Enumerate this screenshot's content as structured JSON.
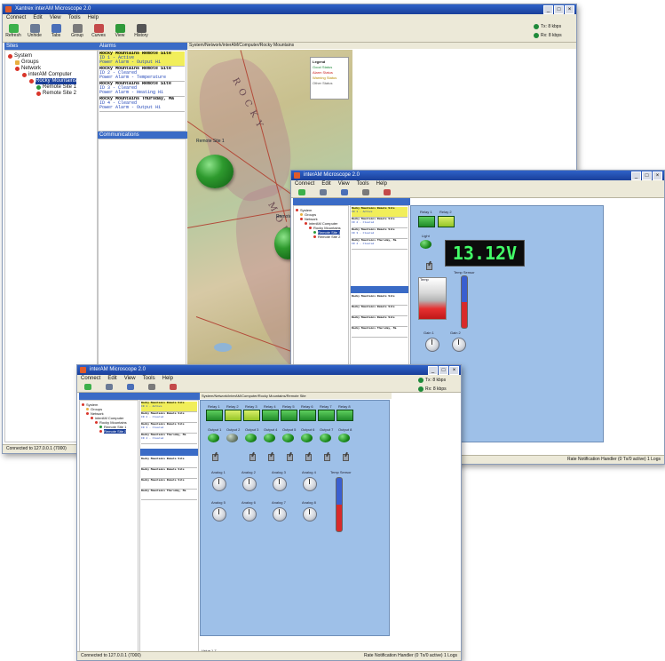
{
  "win1": {
    "title": "Xantrex interAM Microscope 2.0",
    "menu": [
      "Connect",
      "Edit",
      "View",
      "Tools",
      "Help"
    ],
    "toolbar": [
      "Refresh",
      "Unhide",
      "Tabs",
      "Group",
      "Curves",
      "View",
      "History"
    ],
    "speed": [
      "Tx: 8 kbps",
      "Rx: 8 kbps"
    ],
    "sites_header": "Sites",
    "alarms_header": "Alarms",
    "comms_header": "Communications",
    "map_path": "System/Network/interAM/Computer/Rocky Mountains",
    "tree": [
      "System",
      "Groups",
      "Network",
      "interAM Computer",
      "Rocky Mountains",
      "Remote Site 1",
      "Remote Site 2"
    ],
    "alarms": [
      {
        "title": "Rocky Mountains Remote Site",
        "line2": "ID 1 - Active",
        "line3": "Power Alarm - Output Hi"
      },
      {
        "title": "Rocky Mountains Remote Site",
        "line2": "ID 2 - Cleared",
        "line3": "Power Alarm - Temperature"
      },
      {
        "title": "Rocky Mountains Remote Site",
        "line2": "ID 3 - Cleared",
        "line3": "Power Alarm - Heating Hi"
      },
      {
        "title": "Rocky Mountains Thursday, Ma",
        "line2": "ID 4 - Cleared",
        "line3": "Power Alarm - Output Hi"
      }
    ],
    "map_labels": [
      "ROCKY",
      "MOUNTAINS"
    ],
    "site_label_1": "Remote Site 1",
    "site_label_2": "Remote Site 2",
    "legend": [
      "Legend",
      "Good Status",
      "Alarm Status",
      "Warning Status",
      "Other Status"
    ],
    "status": "Connected to 127.0.0.1 (7000)"
  },
  "win2": {
    "title": "interAM Microscope 2.0",
    "menu": [
      "Connect",
      "Edit",
      "View",
      "Tools",
      "Help"
    ],
    "lcd_value": "13.12V",
    "buttons": [
      "Relay 1",
      "Relay 2"
    ],
    "labels": {
      "led": "Light",
      "gauge": "Temp",
      "therm": "Temp Sensor",
      "knob1": "Gain 1",
      "knob2": "Gain 2"
    },
    "status": "Rate Notification Handler (0 Tx/0 active)   1 Logs"
  },
  "win3": {
    "title": "interAM Microscope 2.0",
    "menu": [
      "Connect",
      "Edit",
      "View",
      "Tools",
      "Help"
    ],
    "path": "System/Network/interAM/Computer/Rocky Mountains/Remote Site",
    "relays": [
      "Relay 1",
      "Relay 2",
      "Relay 3",
      "Relay 4",
      "Relay 5",
      "Relay 6",
      "Relay 7",
      "Relay 8"
    ],
    "outputs": [
      "Output 1",
      "Output 2",
      "Output 3",
      "Output 4",
      "Output 5",
      "Output 6",
      "Output 7",
      "Output 8"
    ],
    "analogs": [
      "Analog 1",
      "Analog 2",
      "Analog 3",
      "Analog 4",
      "Analog 5",
      "Analog 6",
      "Analog 7",
      "Analog 8"
    ],
    "therm_label": "Temp Sensor",
    "footer": "Value 1.7",
    "status_left": "Connected to 127.0.0.1 (7000)",
    "status_right": "Rate Notification Handler (0 Tx/0 active)   1 Logs"
  }
}
